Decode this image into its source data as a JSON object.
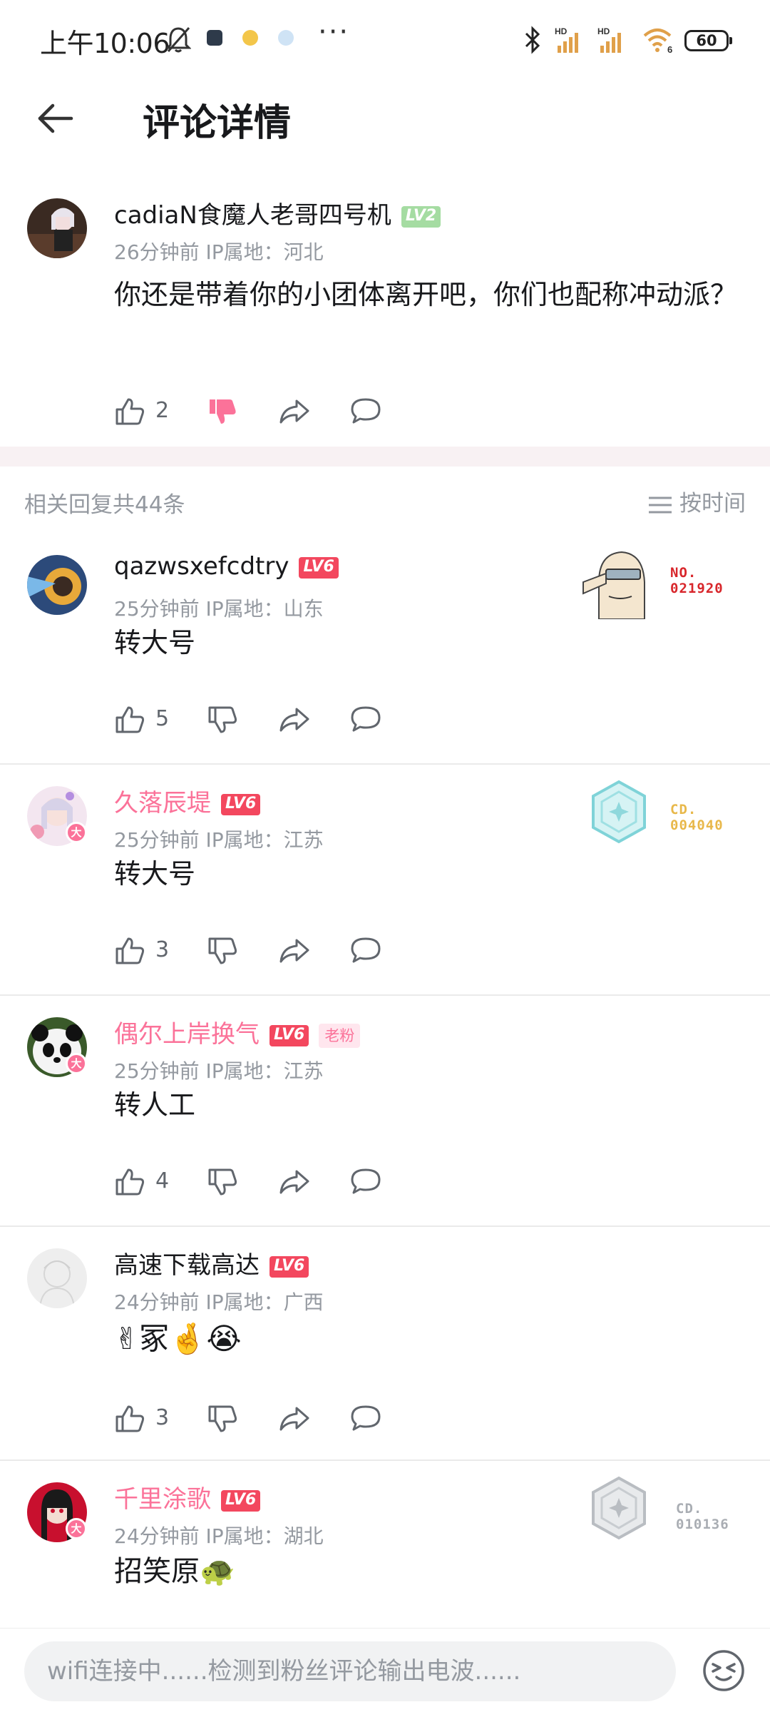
{
  "status_bar": {
    "time": "上午10:06",
    "battery": "60",
    "wifi_sub": "6",
    "hd1": "HD",
    "hd2": "HD",
    "more": "···",
    "icons": [
      "mute-icon",
      "app-notification-icon",
      "emoji-notification-icon",
      "app-notification-icon",
      "bluetooth-icon",
      "signal-icon",
      "wifi-icon",
      "battery-icon"
    ]
  },
  "header": {
    "title": "评论详情",
    "back_icon": "arrow-left-icon"
  },
  "main_comment": {
    "username": "cadiaN食魔人老哥四号机",
    "level": "LV2",
    "meta": "26分钟前 IP属地：河北",
    "content": "你还是带着你的小团体离开吧，你们也配称冲动派？",
    "likes": "2",
    "disliked": true
  },
  "replies_header": {
    "count_text": "相关回复共44条",
    "sort_label": "按时间"
  },
  "replies": [
    {
      "username": "qazwsxefcdtry",
      "level": "LV6",
      "vip": false,
      "meta": "25分钟前 IP属地：山东",
      "content": "转大号",
      "likes": "5",
      "deco_label": "NO.",
      "deco_number": "021920",
      "deco_color": "#d8262b"
    },
    {
      "username": "久落辰堤",
      "level": "LV6",
      "vip": true,
      "meta": "25分钟前 IP属地：江苏",
      "content": "转大号",
      "likes": "3",
      "deco_label": "CD.",
      "deco_number": "004040",
      "deco_color": "#e8b84a"
    },
    {
      "username": "偶尔上岸换气",
      "level": "LV6",
      "vip": true,
      "fan_tag": "老粉",
      "meta": "25分钟前 IP属地：江苏",
      "content": "转人工",
      "likes": "4"
    },
    {
      "username": "高速下载高达",
      "level": "LV6",
      "vip": false,
      "meta": "24分钟前 IP属地：广西",
      "content": "✌冢🤞😭",
      "likes": "3"
    },
    {
      "username": "千里涂歌",
      "level": "LV6",
      "vip": true,
      "meta": "24分钟前 IP属地：湖北",
      "content": "招笑原🐢",
      "deco_label": "CD.",
      "deco_number": "010136",
      "deco_color": "#a9adb3"
    }
  ],
  "input_bar": {
    "placeholder": "wifi连接中......检测到粉丝评论输出电波......",
    "emoji_icon": "emoji-face-icon"
  },
  "colors": {
    "vip_pink": "#fb7299",
    "level_red": "#f3475e",
    "level_green": "#a5dca2",
    "meta_gray": "#9499a0"
  }
}
